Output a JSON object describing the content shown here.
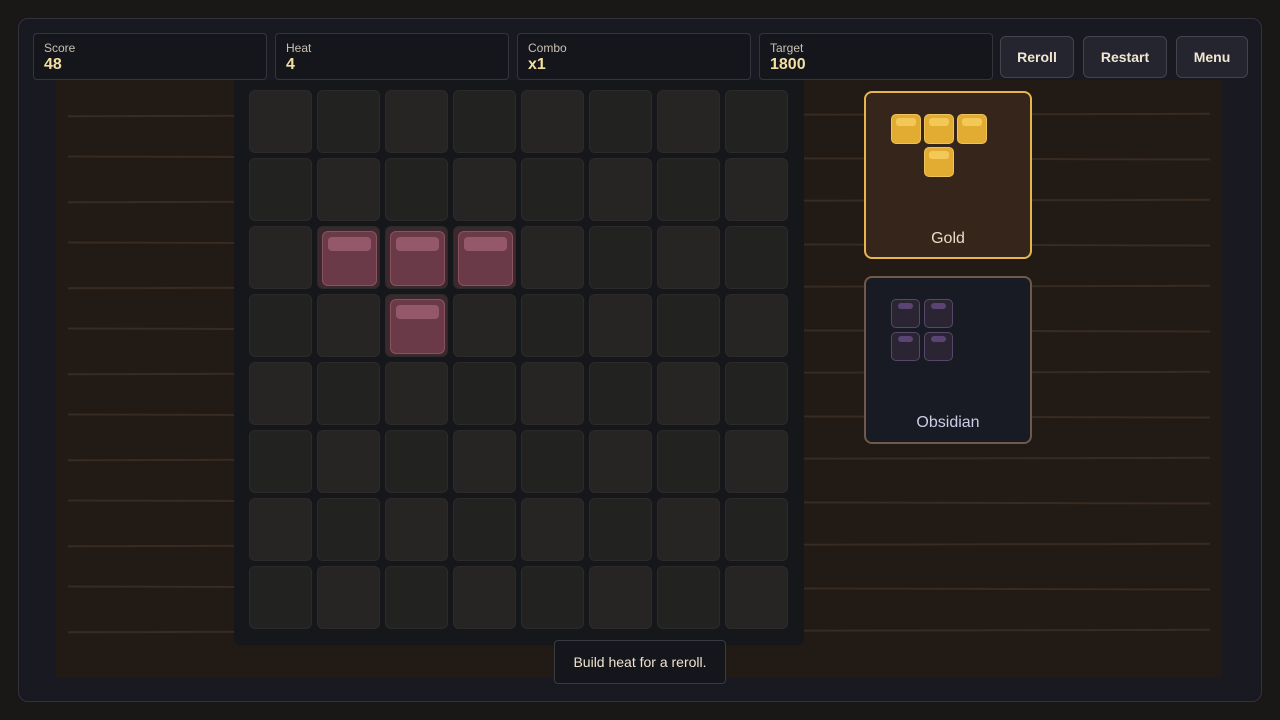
{
  "hud": {
    "stats": [
      {
        "label": "Score",
        "value": "48"
      },
      {
        "label": "Heat",
        "value": "4"
      },
      {
        "label": "Combo",
        "value": "x1"
      },
      {
        "label": "Target",
        "value": "1800"
      }
    ],
    "buttons": {
      "reroll": "Reroll",
      "restart": "Restart",
      "menu": "Menu"
    }
  },
  "board": {
    "rows": 8,
    "cols": 8,
    "filled": [
      [
        2,
        1
      ],
      [
        2,
        2
      ],
      [
        2,
        3
      ],
      [
        3,
        2
      ]
    ]
  },
  "pieces": [
    {
      "name": "Gold",
      "selected": true,
      "cells": [
        [
          0,
          0
        ],
        [
          0,
          1
        ],
        [
          0,
          2
        ],
        [
          1,
          1
        ]
      ],
      "color": "#e2ac32"
    },
    {
      "name": "Obsidian",
      "selected": false,
      "cells": [
        [
          0,
          0
        ],
        [
          0,
          1
        ],
        [
          1,
          0
        ],
        [
          1,
          1
        ]
      ],
      "color": "#2a2433"
    }
  ],
  "hint": "Build heat for a reroll.",
  "colors": {
    "accent": "#e8b54c",
    "filled_block": "#6b3a49",
    "score_text": "#f3dfa0"
  }
}
